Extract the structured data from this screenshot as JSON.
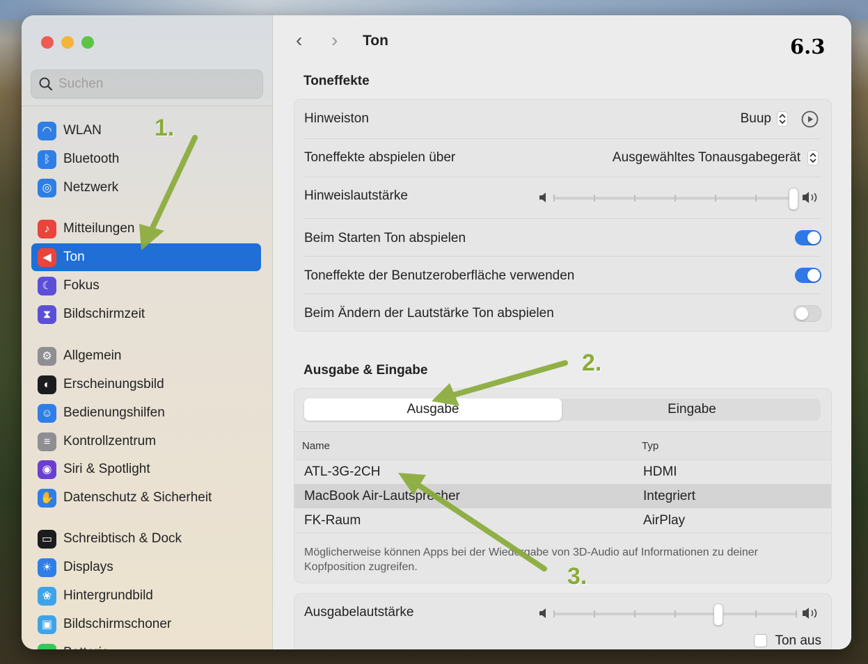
{
  "window": {
    "title": "Ton"
  },
  "sidebar": {
    "search_placeholder": "Suchen",
    "items": [
      {
        "label": "WLAN",
        "icon": "wifi-icon",
        "color": "#2f7ee6"
      },
      {
        "label": "Bluetooth",
        "icon": "bluetooth-icon",
        "color": "#2f7ee6"
      },
      {
        "label": "Netzwerk",
        "icon": "globe-icon",
        "color": "#2f7ee6"
      },
      {
        "label": "Mitteilungen",
        "icon": "bell-icon",
        "color": "#e8453c"
      },
      {
        "label": "Ton",
        "icon": "speaker-icon",
        "color": "#e8453c",
        "active": true
      },
      {
        "label": "Fokus",
        "icon": "moon-icon",
        "color": "#5b4fd8"
      },
      {
        "label": "Bildschirmzeit",
        "icon": "hourglass-icon",
        "color": "#5b4fd8"
      },
      {
        "label": "Allgemein",
        "icon": "gear-icon",
        "color": "#8e8e93"
      },
      {
        "label": "Erscheinungsbild",
        "icon": "appearance-icon",
        "color": "#1c1c1e"
      },
      {
        "label": "Bedienungshilfen",
        "icon": "accessibility-icon",
        "color": "#2f7ee6"
      },
      {
        "label": "Kontrollzentrum",
        "icon": "control-center-icon",
        "color": "#8e8e93"
      },
      {
        "label": "Siri & Spotlight",
        "icon": "siri-icon",
        "color": "#6a3fd0"
      },
      {
        "label": "Datenschutz & Sicherheit",
        "icon": "hand-icon",
        "color": "#2f7ee6"
      },
      {
        "label": "Schreibtisch & Dock",
        "icon": "dock-icon",
        "color": "#1c1c1e"
      },
      {
        "label": "Displays",
        "icon": "sun-icon",
        "color": "#2f7ee6"
      },
      {
        "label": "Hintergrundbild",
        "icon": "flower-icon",
        "color": "#3fa3e8"
      },
      {
        "label": "Bildschirmschoner",
        "icon": "screensaver-icon",
        "color": "#3fa3e8"
      },
      {
        "label": "Batterie",
        "icon": "battery-icon",
        "color": "#34c759"
      }
    ]
  },
  "header": {
    "back": "‹",
    "forward": "›",
    "title": "Ton",
    "page_number": "6.3"
  },
  "sound_effects": {
    "title": "Toneffekte",
    "alert_sound_label": "Hinweiston",
    "alert_sound_value": "Buup",
    "play_through_label": "Toneffekte abspielen über",
    "play_through_value": "Ausgewähltes Tonausgabegerät",
    "alert_volume_label": "Hinweislautstärke",
    "alert_volume_level": 1.0,
    "startup_label": "Beim Starten Ton abspielen",
    "startup_on": true,
    "ui_effects_label": "Toneffekte der Benutzeroberfläche verwenden",
    "ui_effects_on": true,
    "volume_feedback_label": "Beim Ändern der Lautstärke Ton abspielen",
    "volume_feedback_on": false
  },
  "io": {
    "title": "Ausgabe & Eingabe",
    "tab_output": "Ausgabe",
    "tab_input": "Eingabe",
    "col_name": "Name",
    "col_type": "Typ",
    "devices": [
      {
        "name": "ATL-3G-2CH",
        "type": "HDMI"
      },
      {
        "name": "MacBook Air-Lautsprecher",
        "type": "Integriert",
        "selected": true
      },
      {
        "name": "FK-Raum",
        "type": "AirPlay"
      }
    ],
    "note": "Möglicherweise können Apps bei der Wiedergabe von 3D-Audio auf Informationen zu deiner Kopfposition zugreifen."
  },
  "output_volume": {
    "label": "Ausgabelautstärke",
    "level": 0.68,
    "mute_label": "Ton aus",
    "muted": false
  },
  "annotations": {
    "a1": "1.",
    "a2": "2.",
    "a3": "3.",
    "color": "#8aab3a"
  }
}
